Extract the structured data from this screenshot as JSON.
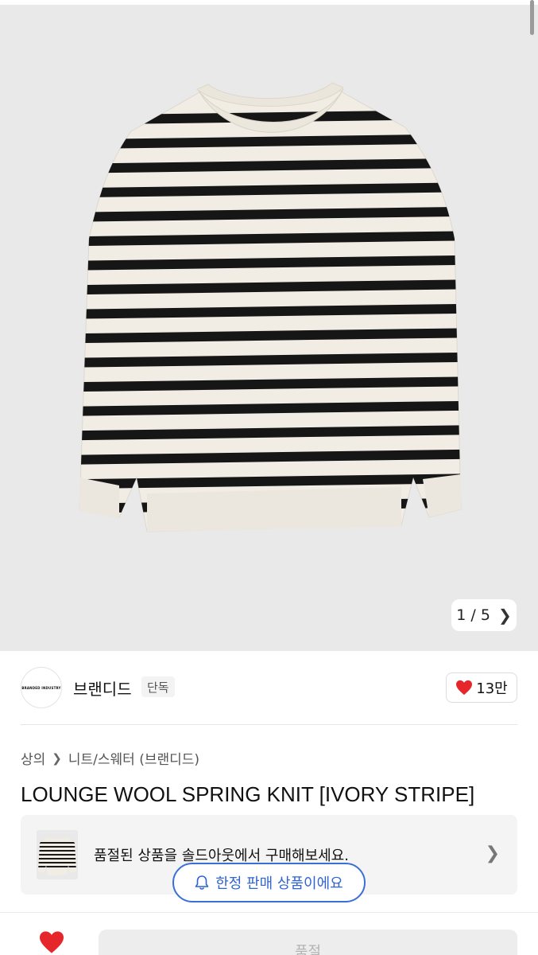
{
  "gallery": {
    "current": "1",
    "separator": "/",
    "total": "5",
    "next_icon": "chevron-right-icon",
    "background_color": "#e9e9ea"
  },
  "brand": {
    "logo_text": "BRANDED INDUSTRY",
    "name": "브랜디드",
    "tag": "단독",
    "like_icon": "heart-icon",
    "like_count": "13만",
    "accent_color": "#e5262b"
  },
  "product": {
    "breadcrumb": [
      "상의",
      "니트/스웨터 (브랜디드)"
    ],
    "title": "LOUNGE WOOL SPRING KNIT [IVORY STRIPE]"
  },
  "soldout_banner": {
    "text": "품절된 상품을 솔드아웃에서 구매해보세요.",
    "chevron_icon": "chevron-right-icon"
  },
  "limited_badge": {
    "icon": "bell-icon",
    "text": "한정 판매 상품이에요",
    "color": "#2f64d1"
  },
  "bottom_bar": {
    "wishlist_icon": "heart-icon",
    "button_label": "품절"
  }
}
